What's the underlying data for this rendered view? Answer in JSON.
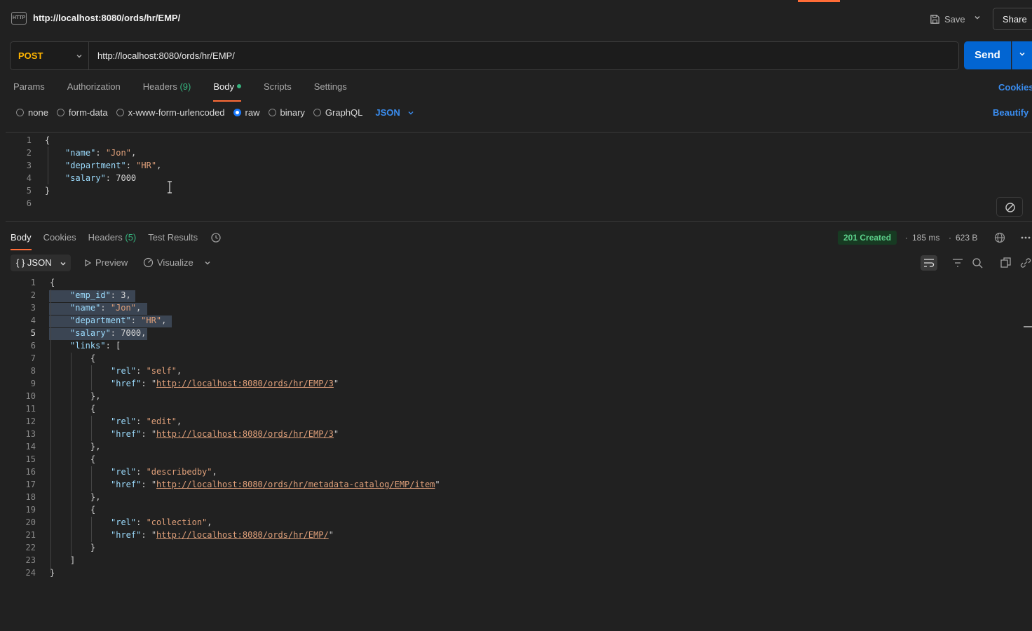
{
  "header": {
    "icon": "http-icon",
    "icon_text": "HTTP",
    "title": "http://localhost:8080/ords/hr/EMP/",
    "save_label": "Save",
    "share_label": "Share"
  },
  "request": {
    "method": "POST",
    "url": "http://localhost:8080/ords/hr/EMP/",
    "send_label": "Send",
    "tabs": {
      "params": "Params",
      "authorization": "Authorization",
      "headers": "Headers",
      "headers_count": "(9)",
      "body": "Body",
      "scripts": "Scripts",
      "settings": "Settings"
    },
    "cookies_label": "Cookies",
    "body_types": {
      "none": "none",
      "form_data": "form-data",
      "urlencoded": "x-www-form-urlencoded",
      "raw": "raw",
      "binary": "binary",
      "graphql": "GraphQL"
    },
    "selected_body_type": "raw",
    "language": "JSON",
    "beautify_label": "Beautify",
    "body_lines": [
      "1",
      "2",
      "3",
      "4",
      "5",
      "6"
    ],
    "body": {
      "open": "{",
      "k_name": "\"name\"",
      "v_name": "\"Jon\"",
      "k_department": "\"department\"",
      "v_department": "\"HR\"",
      "k_salary": "\"salary\"",
      "v_salary": "7000",
      "close": "}"
    }
  },
  "response": {
    "tabs": {
      "body": "Body",
      "cookies": "Cookies",
      "headers": "Headers",
      "headers_count": "(5)",
      "test_results": "Test Results"
    },
    "status": "201 Created",
    "time": "185 ms",
    "size": "623 B",
    "format": "{ } JSON",
    "preview_label": "Preview",
    "visualize_label": "Visualize",
    "body": {
      "k_emp_id": "\"emp_id\"",
      "v_emp_id": "3",
      "k_name": "\"name\"",
      "v_name": "\"Jon\"",
      "k_department": "\"department\"",
      "v_department": "\"HR\"",
      "k_salary": "\"salary\"",
      "v_salary": "7000",
      "k_links": "\"links\"",
      "k_rel": "\"rel\"",
      "k_href": "\"href\"",
      "links": [
        {
          "rel": "\"self\"",
          "href": "http://localhost:8080/ords/hr/EMP/3"
        },
        {
          "rel": "\"edit\"",
          "href": "http://localhost:8080/ords/hr/EMP/3"
        },
        {
          "rel": "\"describedby\"",
          "href": "http://localhost:8080/ords/hr/metadata-catalog/EMP/item"
        },
        {
          "rel": "\"collection\"",
          "href": "http://localhost:8080/ords/hr/EMP/"
        }
      ]
    }
  },
  "colors": {
    "accent": "#ff6c37",
    "send": "#0265d2",
    "method": "#ffb400",
    "status_ok": "#5cd08a",
    "link": "#3a8df0"
  }
}
